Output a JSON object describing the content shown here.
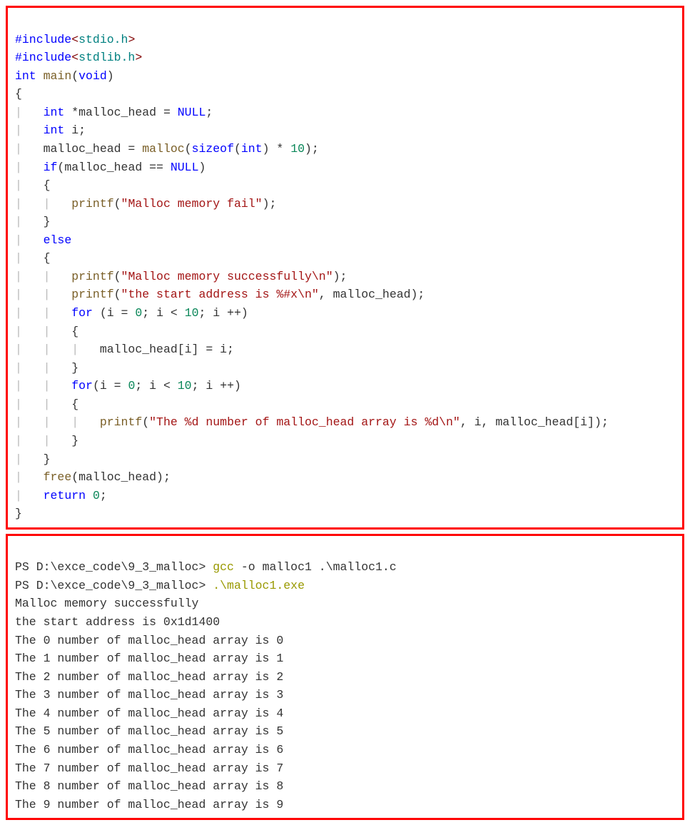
{
  "code": {
    "l1": {
      "pp": "#include",
      "lt": "<",
      "hdr": "stdio.h",
      "gt": ">"
    },
    "l2": {
      "pp": "#include",
      "lt": "<",
      "hdr": "stdlib.h",
      "gt": ">"
    },
    "l3": {
      "kw_int": "int",
      "main": "main",
      "lp": "(",
      "kw_void": "void",
      "rp": ")"
    },
    "l4": "{",
    "l5": {
      "kw": "int",
      "rest": " *malloc_head = ",
      "nul": "NULL",
      "semi": ";"
    },
    "l6": {
      "kw": "int",
      "rest": " i;"
    },
    "l7": {
      "a": "malloc_head = ",
      "fn": "malloc",
      "b": "(",
      "sz": "sizeof",
      "c": "(",
      "ty": "int",
      "d": ") * ",
      "num": "10",
      "e": ");"
    },
    "l8": {
      "kw": "if",
      "a": "(malloc_head == ",
      "nul": "NULL",
      "b": ")"
    },
    "l9": "{",
    "l10": {
      "fn": "printf",
      "a": "(",
      "str": "\"Malloc memory fail\"",
      "b": ");"
    },
    "l11": "}",
    "l12": {
      "kw": "else"
    },
    "l13": "{",
    "l14": {
      "fn": "printf",
      "a": "(",
      "str": "\"Malloc memory successfully\\n\"",
      "b": ");"
    },
    "l15": {
      "fn": "printf",
      "a": "(",
      "str": "\"the start address is %#x\\n\"",
      "b": ", malloc_head);"
    },
    "l16": {
      "kw": "for",
      "a": " (i = ",
      "n0": "0",
      "b": "; i < ",
      "n10": "10",
      "c": "; i ++)"
    },
    "l17": "{",
    "l18": "malloc_head[i] = i;",
    "l19": "}",
    "l20": {
      "kw": "for",
      "a": "(i = ",
      "n0": "0",
      "b": "; i < ",
      "n10": "10",
      "c": "; i ++)"
    },
    "l21": "{",
    "l22": {
      "fn": "printf",
      "a": "(",
      "str": "\"The %d number of malloc_head array is %d\\n\"",
      "b": ", i, malloc_head[i]);"
    },
    "l23": "}",
    "l24": "}",
    "l25": {
      "fn": "free",
      "a": "(malloc_head);"
    },
    "l26": {
      "kw": "return",
      "sp": " ",
      "num": "0",
      "semi": ";"
    },
    "l27": "}"
  },
  "terminal": {
    "prompt1": "PS D:\\exce_code\\9_3_malloc> ",
    "cmd1a": "gcc",
    "cmd1b": " -o malloc1 .\\malloc1.c",
    "prompt2": "PS D:\\exce_code\\9_3_malloc> ",
    "cmd2": ".\\malloc1.exe",
    "out": [
      "Malloc memory successfully",
      "the start address is 0x1d1400",
      "The 0 number of malloc_head array is 0",
      "The 1 number of malloc_head array is 1",
      "The 2 number of malloc_head array is 2",
      "The 3 number of malloc_head array is 3",
      "The 4 number of malloc_head array is 4",
      "The 5 number of malloc_head array is 5",
      "The 6 number of malloc_head array is 6",
      "The 7 number of malloc_head array is 7",
      "The 8 number of malloc_head array is 8",
      "The 9 number of malloc_head array is 9"
    ]
  }
}
